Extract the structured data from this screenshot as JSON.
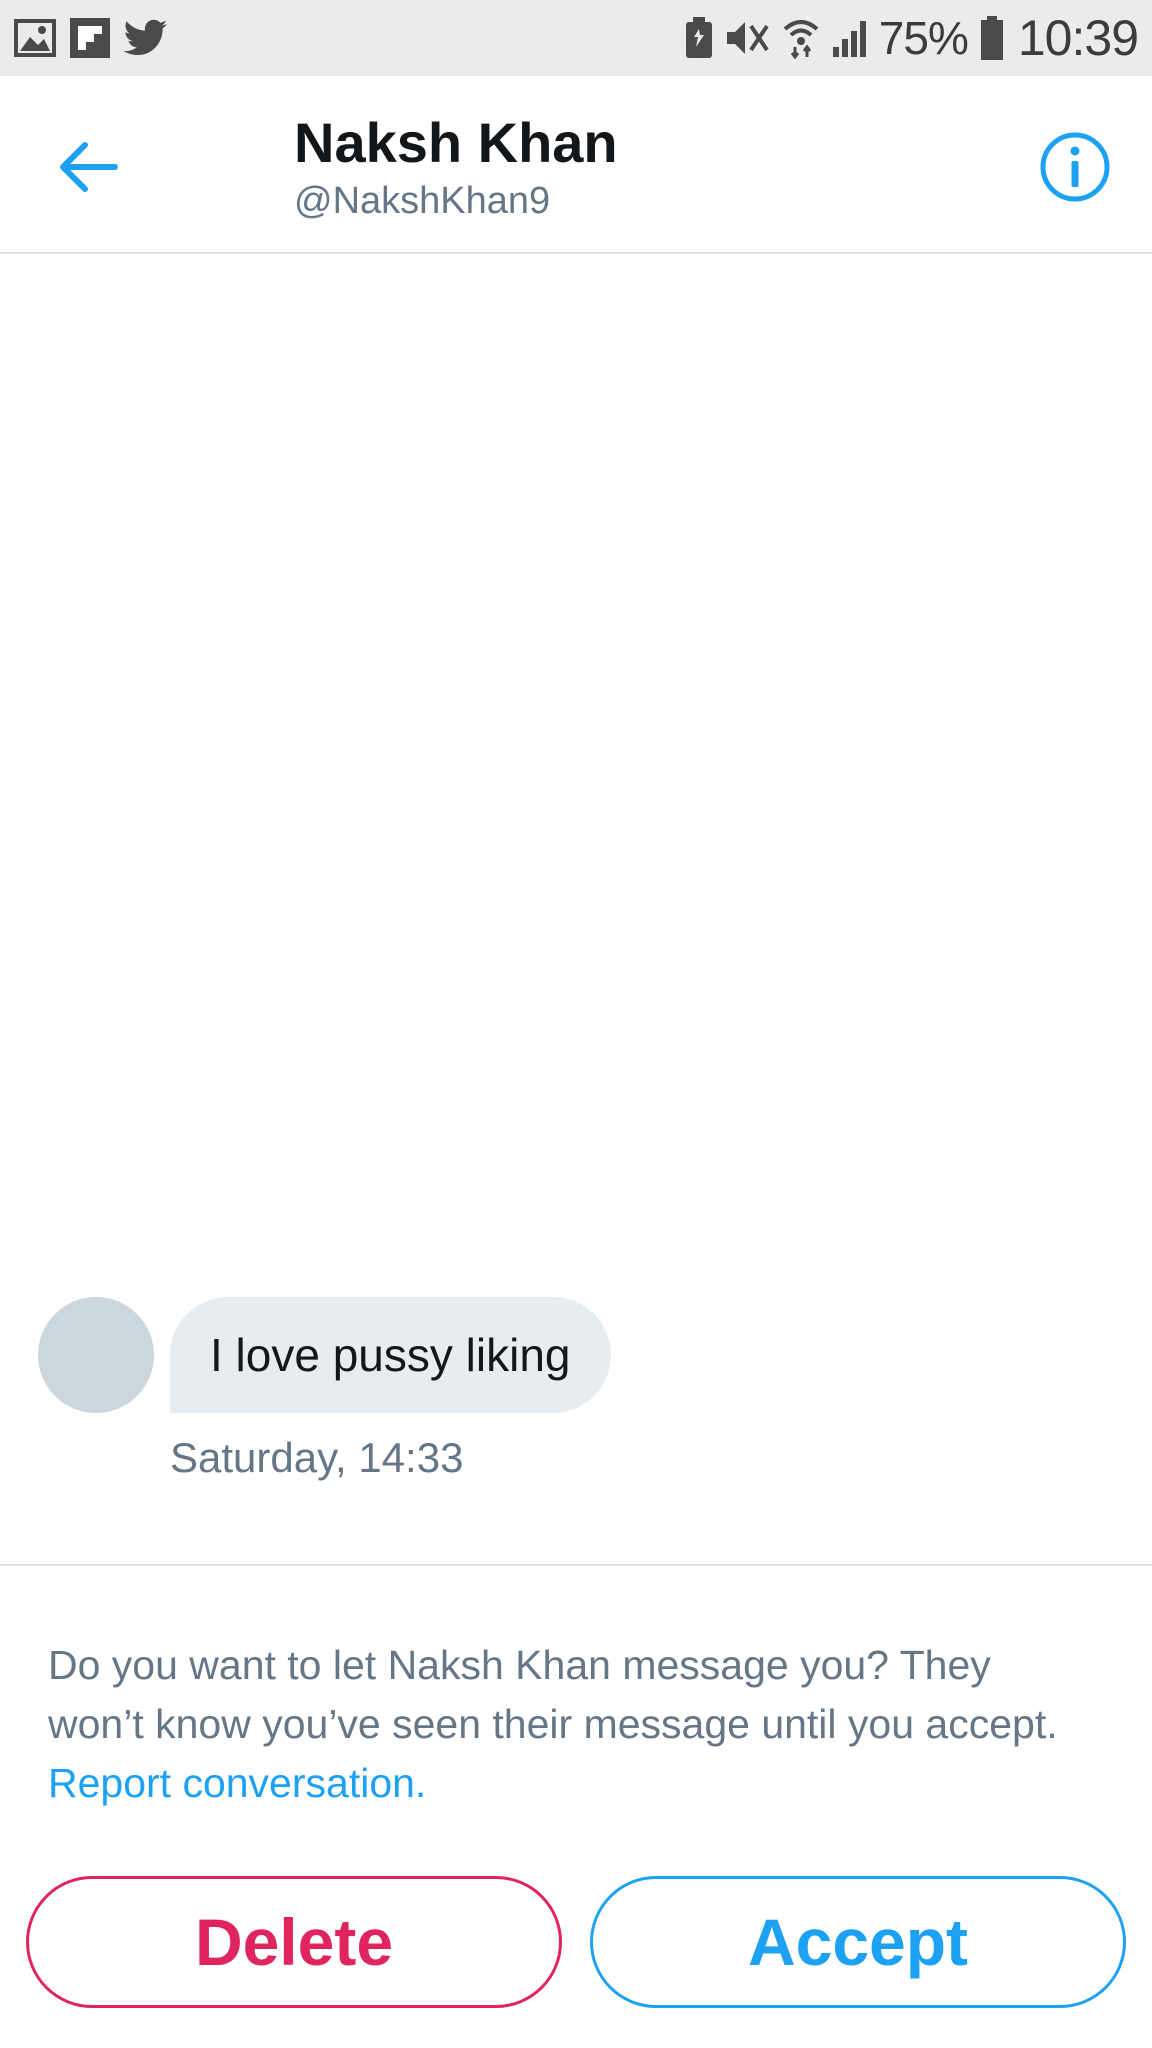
{
  "status_bar": {
    "battery_percent": "75%",
    "time": "10:39",
    "icons_left": [
      "gallery-icon",
      "flipboard-icon",
      "twitter-icon"
    ],
    "icons_right": [
      "battery-saver-icon",
      "mute-icon",
      "wifi-icon",
      "signal-icon",
      "battery-icon"
    ]
  },
  "header": {
    "name": "Naksh Khan",
    "handle": "@NakshKhan9",
    "back_icon": "arrow-left-icon",
    "info_icon": "info-icon"
  },
  "message": {
    "text": "I love pussy liking",
    "timestamp": "Saturday, 14:33"
  },
  "request": {
    "prompt": "Do you want to let Naksh Khan message you? They won’t know you’ve seen their message until you accept. ",
    "report_link": "Report conversation.",
    "delete_label": "Delete",
    "accept_label": "Accept"
  },
  "colors": {
    "accent": "#1da1f2",
    "delete": "#e0245e",
    "secondary_text": "#657786",
    "bubble": "#e6ecf0",
    "avatar_placeholder": "#ccd6dd"
  }
}
